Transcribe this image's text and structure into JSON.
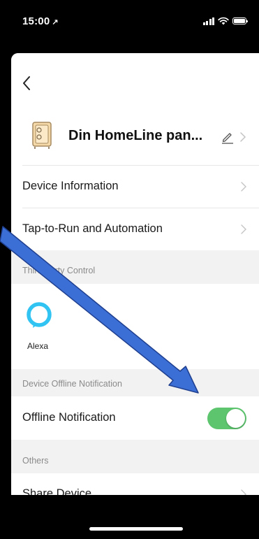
{
  "status_bar": {
    "time": "15:00",
    "location_glyph": "↗"
  },
  "nav": {
    "back_icon": "chevron-left-icon"
  },
  "device": {
    "name": "Din HomeLine pan...",
    "icon": "device-panel-icon",
    "edit_icon": "pencil-icon"
  },
  "rows": {
    "device_information": "Device Information",
    "tap_to_run": "Tap-to-Run and Automation"
  },
  "sections": {
    "third_party": "Third-party Control",
    "offline": "Device Offline Notification",
    "others": "Others"
  },
  "third_party": {
    "alexa_label": "Alexa",
    "alexa_color": "#31c4f3"
  },
  "offline_notification": {
    "label": "Offline Notification",
    "enabled": true,
    "toggle_color": "#5cc56e"
  },
  "share": {
    "label": "Share Device"
  },
  "annotation": {
    "arrow_color": "#3b6fd6"
  }
}
